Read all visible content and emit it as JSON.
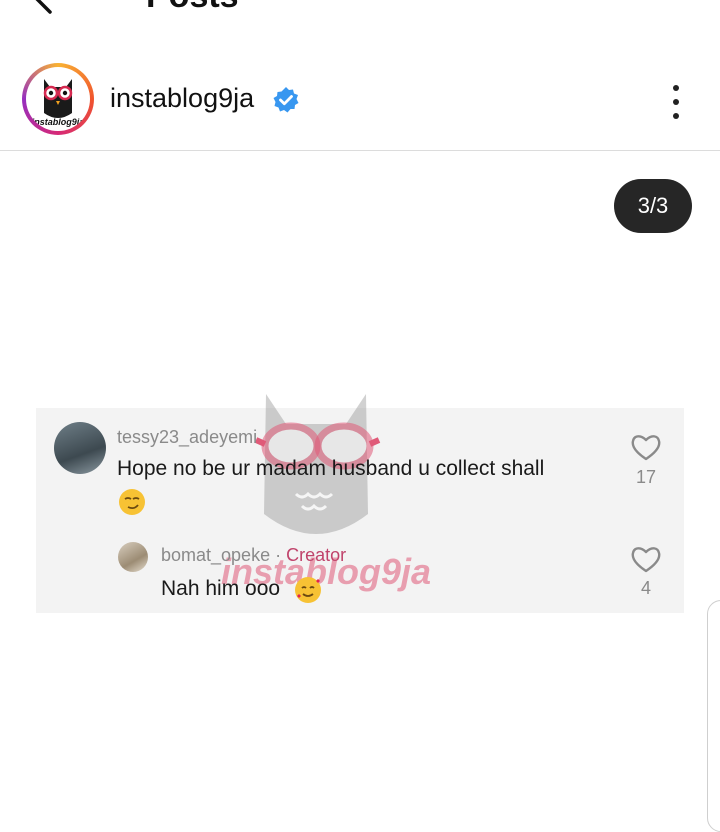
{
  "topbar": {
    "title": "Posts",
    "back_icon": "arrow-left-icon"
  },
  "profile": {
    "username": "instablog9ja",
    "avatar_text": "instablog9ja",
    "verified_icon": "verified-badge-icon",
    "verified_color": "#3897f0",
    "more_icon": "more-vertical-icon"
  },
  "carousel": {
    "counter": "3/3"
  },
  "comments": [
    {
      "username": "tessy23_adeyemi",
      "text": "Hope no be ur madam husband u collect shall",
      "emoji": "smirk-emoji",
      "likes": "17",
      "like_icon": "heart-outline-icon"
    },
    {
      "username": "bomat_opeke",
      "separator": "·",
      "role": "Creator",
      "role_color": "#c0436b",
      "text": "Nah him ooo",
      "emoji": "smiling-face-with-hearts-emoji",
      "likes": "4",
      "like_icon": "heart-outline-icon"
    }
  ],
  "watermark": {
    "text": "instablog9ja",
    "color": "#c0436b"
  }
}
